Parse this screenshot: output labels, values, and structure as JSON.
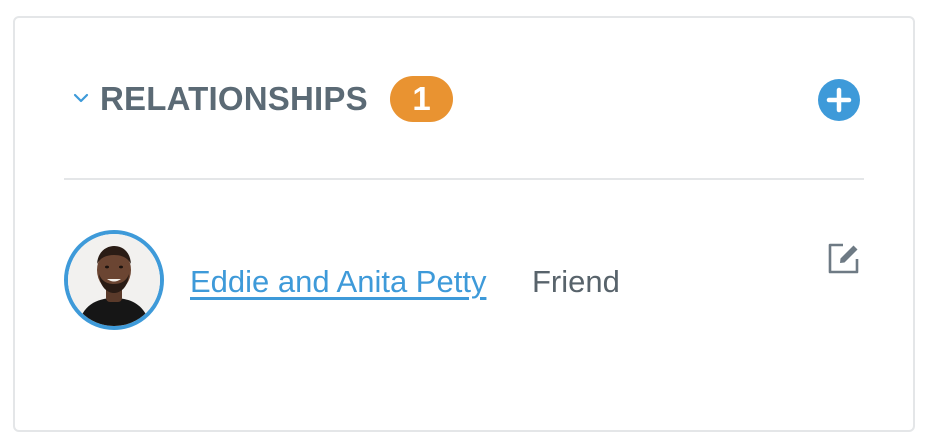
{
  "section": {
    "title": "RELATIONSHIPS",
    "count": "1",
    "collapse_icon": "chevron-down-icon",
    "add_icon": "plus-circle-icon"
  },
  "relationships": [
    {
      "name": "Eddie and Anita Petty",
      "relation": "Friend",
      "avatar": "person-avatar",
      "edit_icon": "edit-icon"
    }
  ],
  "colors": {
    "accent": "#3e9ad9",
    "badge": "#e99331",
    "title": "#5b6a75",
    "text": "#58636b",
    "border": "#e4e6e8"
  }
}
